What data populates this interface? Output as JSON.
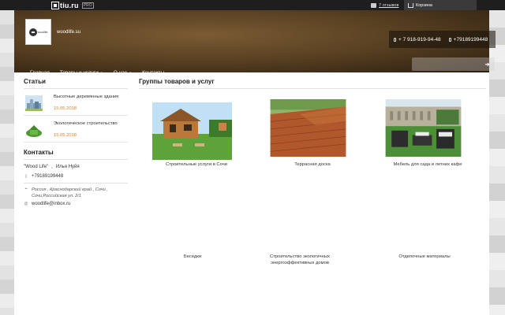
{
  "topbar": {
    "brand": "tiu.ru",
    "brand_tag": "PRO",
    "reviews": "7 отзывов",
    "cart": "Корзина"
  },
  "header": {
    "logo_word": "woodlife",
    "site_name": "woodlife.su",
    "phones": [
      "+ 7 918-919-94-48",
      "+79189199448"
    ],
    "search_placeholder": ""
  },
  "nav": [
    {
      "label": "Главная",
      "has_dropdown": false
    },
    {
      "label": "Товары и услуги",
      "has_dropdown": true
    },
    {
      "label": "О нас",
      "has_dropdown": true
    },
    {
      "label": "Контакты",
      "has_dropdown": false
    }
  ],
  "sidebar": {
    "articles_title": "Статьи",
    "articles": [
      {
        "title": "Высотные деревянные здания",
        "date": "15.05.2018"
      },
      {
        "title": "Экологическое строительство",
        "date": "15.05.2018"
      }
    ],
    "contacts_title": "Контакты",
    "company": "\"Wood Life\"",
    "person": "Илья Нуйя",
    "phone": "+79189199448",
    "address_line1": "Россия , Краснодарский край , Сочи ,",
    "address_line2": "Сочи,Российская ул. 2/1",
    "email": "woodlife@inbox.ru"
  },
  "main": {
    "title": "Группы товаров и услуг",
    "groups": [
      {
        "label": "Строительные услуги в Сочи",
        "has_image": true
      },
      {
        "label": "Террасная доска",
        "has_image": true
      },
      {
        "label": "Мебель для сада и летних кафе",
        "has_image": true
      },
      {
        "label": "Беседки",
        "has_image": false
      },
      {
        "label": "Строительство экологичных энергоэффективных домов",
        "has_image": false
      },
      {
        "label": "Отделочные материалы",
        "has_image": false
      }
    ]
  },
  "colors": {
    "accent_date": "#d4832a",
    "topbar": "#1e1e1e",
    "header_brown": "#5b4223"
  }
}
